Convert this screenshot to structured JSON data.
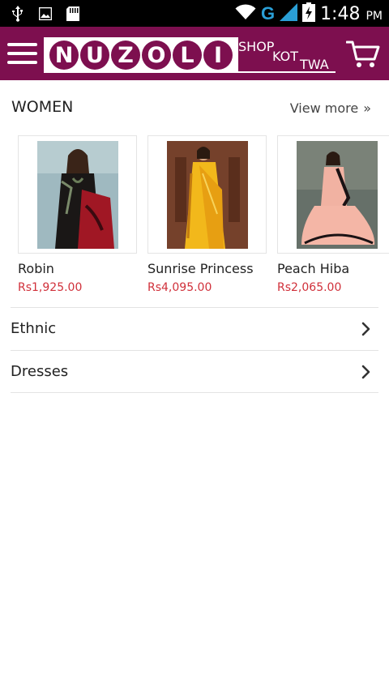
{
  "status_bar": {
    "network_letter": "G",
    "time": "1:48",
    "time_suffix": "PM",
    "icons": [
      "usb-icon",
      "image-icon",
      "sd-card-icon",
      "wifi-icon",
      "signal-icon",
      "battery-charging-icon"
    ]
  },
  "app_bar": {
    "background_color": "#7d0f4f",
    "logo": {
      "letters": [
        "N",
        "U",
        "Z",
        "O",
        "L",
        "I"
      ],
      "tagline": [
        "SHOP",
        "KOT",
        "TWA"
      ]
    },
    "icons": [
      "menu-icon",
      "cart-icon"
    ]
  },
  "section": {
    "title": "WOMEN",
    "view_more": "View more",
    "view_more_chevron": "»"
  },
  "products": [
    {
      "name": "Robin",
      "price": "Rs1,925.00"
    },
    {
      "name": "Sunrise Princess",
      "price": "Rs4,095.00"
    },
    {
      "name": "Peach Hiba",
      "price": "Rs2,065.00"
    }
  ],
  "categories": [
    {
      "label": "Ethnic"
    },
    {
      "label": "Dresses"
    }
  ],
  "colors": {
    "accent": "#7d0f4f",
    "price": "#d0303a"
  }
}
